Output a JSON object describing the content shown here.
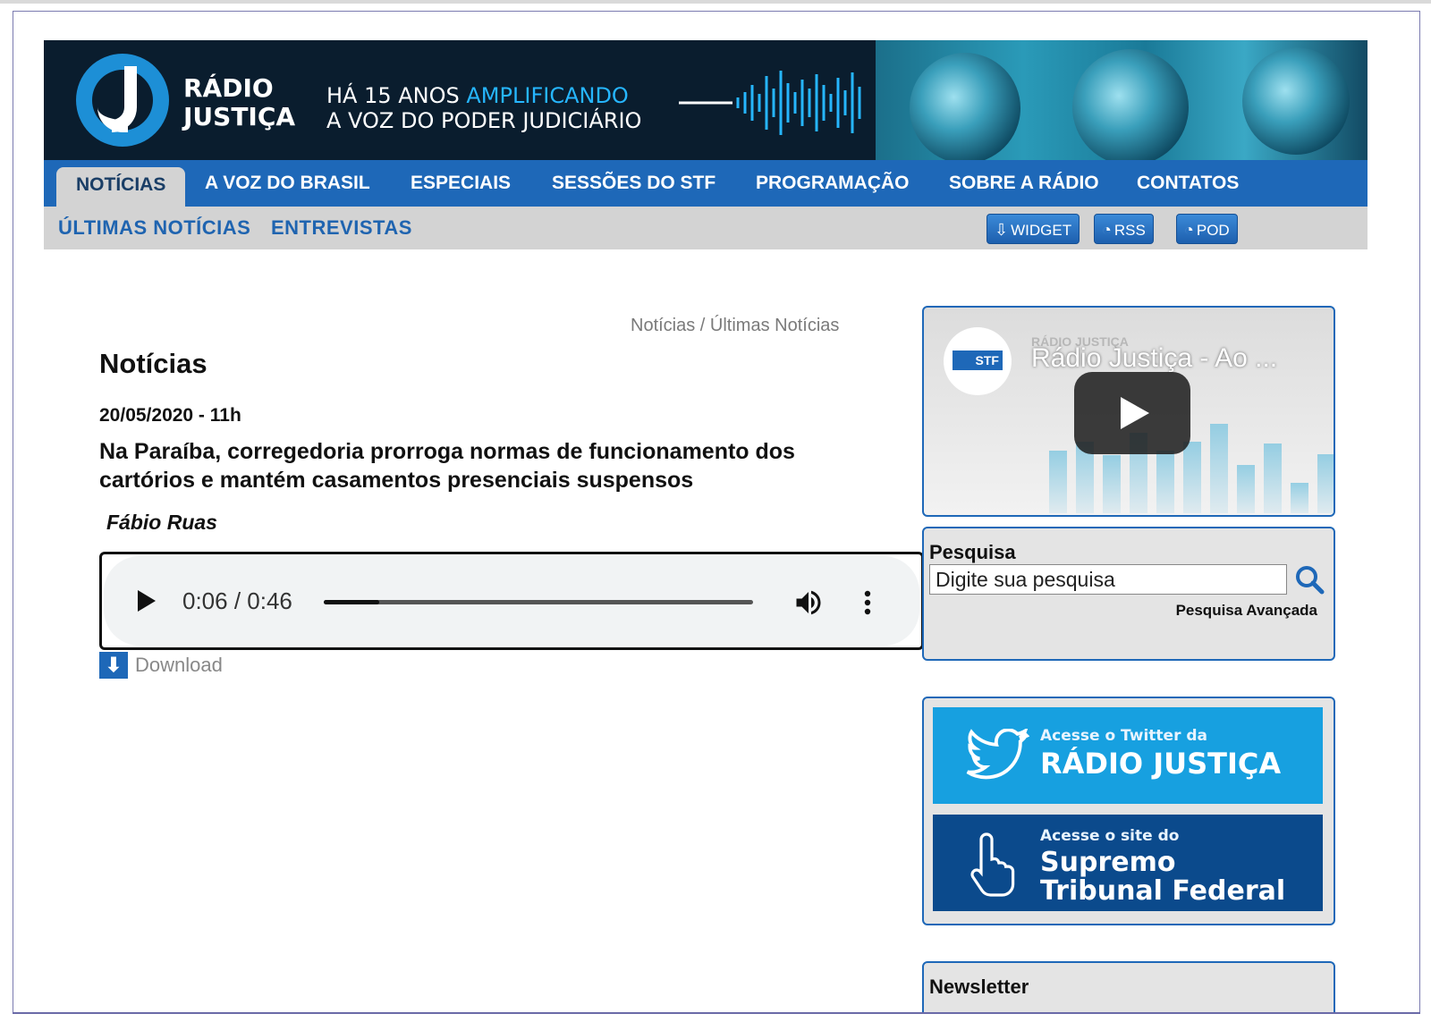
{
  "banner": {
    "brand_line1": "RÁDIO",
    "brand_line2": "JUSTIÇA",
    "tagline_prefix": "HÁ 15 ANOS ",
    "tagline_accent": "AMPLIFICANDO",
    "tagline_line2": "A VOZ DO PODER JUDICIÁRIO"
  },
  "nav": {
    "items": [
      "NOTÍCIAS",
      "A VOZ DO BRASIL",
      "ESPECIAIS",
      "SESSÕES DO STF",
      "PROGRAMAÇÃO",
      "SOBRE A RÁDIO",
      "CONTATOS"
    ],
    "active": "NOTÍCIAS"
  },
  "subnav": {
    "items": [
      "ÚLTIMAS NOTÍCIAS",
      "ENTREVISTAS"
    ],
    "feeds": [
      "WIDGET",
      "RSS",
      "POD"
    ]
  },
  "breadcrumb": "Notícias / Últimas Notícias",
  "article": {
    "section_title": "Notícias",
    "date": "20/05/2020 - 11h",
    "headline": "Na Paraíba, corregedoria prorroga normas de funcionamento dos cartórios e mantém casamentos presenciais suspensos",
    "author": "Fábio Ruas",
    "audio": {
      "time": "0:06 / 0:46",
      "progress": 0.13
    },
    "download_label": "Download"
  },
  "sidebar": {
    "video": {
      "brand": "RÁDIO JUSTIÇA",
      "logo": "STF",
      "title": "Rádio Justiça - Ao ..."
    },
    "search": {
      "label": "Pesquisa",
      "placeholder": "Digite sua pesquisa",
      "advanced": "Pesquisa Avançada"
    },
    "twitter_promo": {
      "small": "Acesse o Twitter da",
      "big": "RÁDIO JUSTIÇA"
    },
    "stf_promo": {
      "small": "Acesse o site do",
      "big_line1": "Supremo",
      "big_line2": "Tribunal Federal"
    },
    "newsletter_label": "Newsletter"
  },
  "colors": {
    "nav_blue": "#1e68b8",
    "accent_cyan": "#26b6ff",
    "banner_dark": "#0a1d2e",
    "twitter_blue": "#17a0e0",
    "stf_blue": "#0b4a8c"
  }
}
